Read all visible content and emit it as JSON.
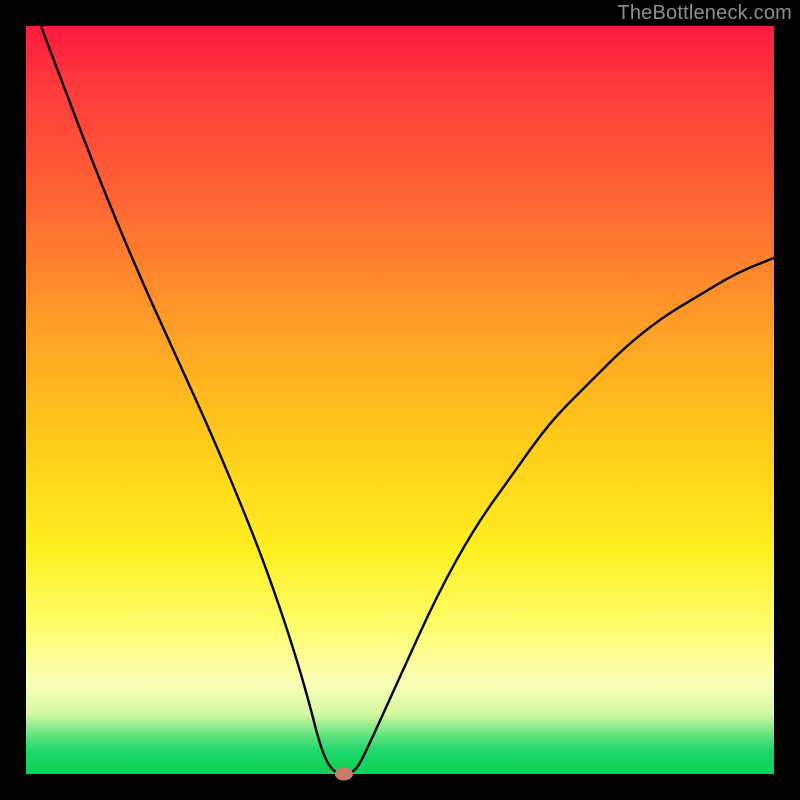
{
  "watermark": "TheBottleneck.com",
  "colors": {
    "background": "#000000",
    "gradient_top": "#ff1a40",
    "gradient_mid1": "#ff9e26",
    "gradient_mid2": "#ffef20",
    "gradient_bottom": "#0ccf58",
    "curve": "#000000",
    "marker": "#c97b6c"
  },
  "chart_data": {
    "type": "line",
    "title": "",
    "xlabel": "",
    "ylabel": "",
    "xlim": [
      0,
      100
    ],
    "ylim": [
      0,
      100
    ],
    "grid": false,
    "legend": false,
    "series": [
      {
        "name": "curve",
        "x": [
          2,
          5,
          10,
          15,
          20,
          25,
          30,
          33,
          36,
          38,
          39,
          40,
          41,
          42,
          43,
          44,
          45,
          50,
          55,
          60,
          65,
          70,
          75,
          80,
          85,
          90,
          95,
          100
        ],
        "y": [
          100,
          92,
          79,
          67,
          56,
          45,
          33,
          25,
          16,
          9,
          5,
          2,
          0.5,
          0,
          0,
          0.5,
          2,
          13,
          24,
          33,
          40,
          47,
          52,
          57,
          61,
          64,
          67,
          69
        ]
      }
    ],
    "marker": {
      "x": 42.5,
      "y": 0,
      "label": "optimal-point"
    },
    "notes": "Curve descends from top-left, reaches minimum (~0) near x≈42, then rises toward upper-right with diminishing slope. Background gradient encodes value: red=high (bad), green=low (good)."
  }
}
